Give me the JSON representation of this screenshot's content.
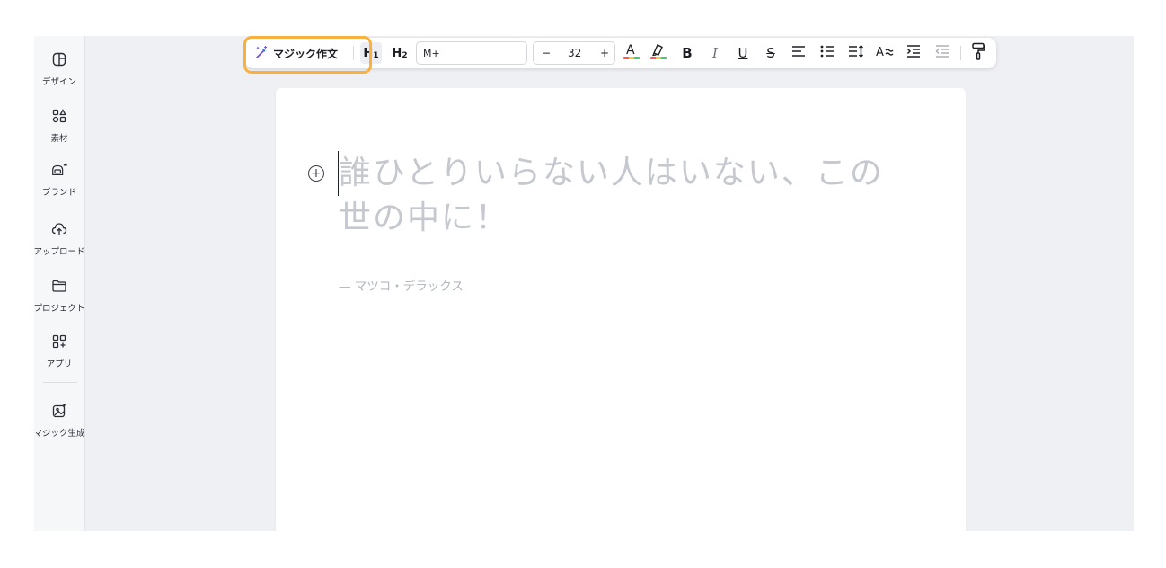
{
  "sidebar": {
    "items": [
      {
        "label": "デザイン",
        "icon": "design-icon"
      },
      {
        "label": "素材",
        "icon": "elements-icon"
      },
      {
        "label": "ブランド",
        "icon": "brand-icon"
      },
      {
        "label": "アップロード",
        "icon": "upload-icon"
      },
      {
        "label": "プロジェクト",
        "icon": "folder-icon"
      },
      {
        "label": "アプリ",
        "icon": "apps-icon"
      },
      {
        "label": "マジック生成",
        "icon": "magic-media-icon"
      }
    ]
  },
  "toolbar": {
    "magic_write_label": "マジック作文",
    "h1_label": "H",
    "h1_sub": "1",
    "h2_label": "H",
    "h2_sub": "2",
    "font_name": "M+",
    "font_size_minus": "−",
    "font_size": "32",
    "font_size_plus": "+",
    "bold": "B",
    "italic": "I",
    "underline": "U",
    "strike": "S",
    "effects": "A"
  },
  "document": {
    "heading": "誰ひとりいらない人はいない、この世の中に！",
    "attribution": "— マツコ・デラックス"
  },
  "colors": {
    "highlight": "#f9b040",
    "canvas_bg": "#eef0f4",
    "placeholder_text": "#c5c8cf"
  }
}
